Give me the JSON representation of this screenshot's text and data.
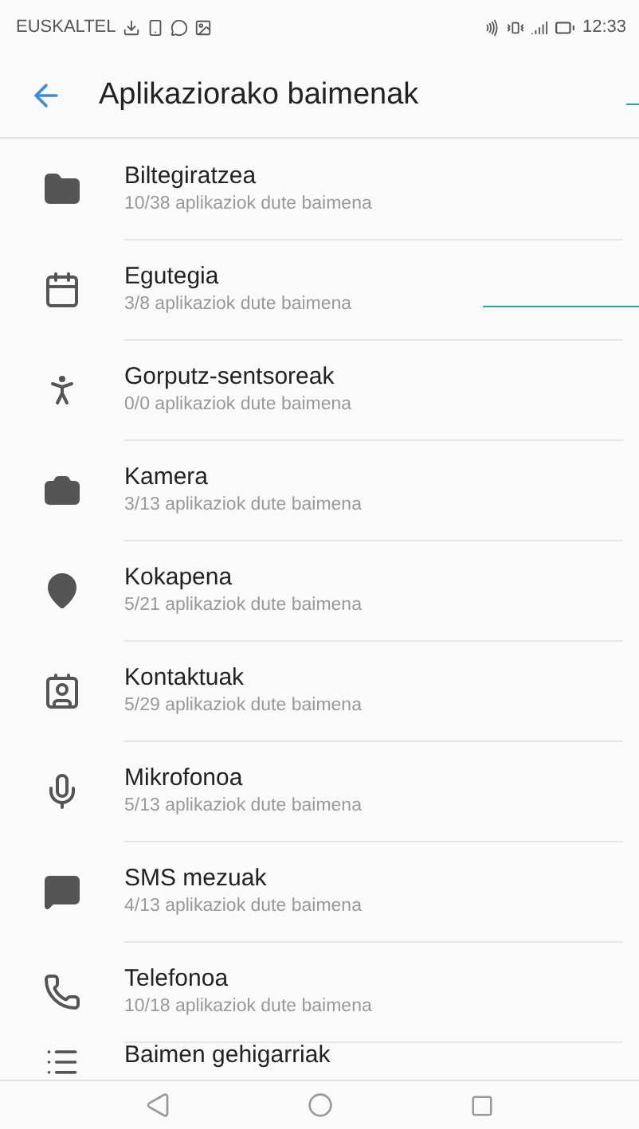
{
  "status_bar": {
    "carrier": "EUSKALTEL",
    "time": "12:33"
  },
  "header": {
    "title": "Aplikaziorako baimenak"
  },
  "permissions": [
    {
      "title": "Biltegiratzea",
      "subtitle": "10/38 aplikaziok dute baimena"
    },
    {
      "title": "Egutegia",
      "subtitle": "3/8 aplikaziok dute baimena"
    },
    {
      "title": "Gorputz-sentsoreak",
      "subtitle": "0/0 aplikaziok dute baimena"
    },
    {
      "title": "Kamera",
      "subtitle": "3/13 aplikaziok dute baimena"
    },
    {
      "title": "Kokapena",
      "subtitle": "5/21 aplikaziok dute baimena"
    },
    {
      "title": "Kontaktuak",
      "subtitle": "5/29 aplikaziok dute baimena"
    },
    {
      "title": "Mikrofonoa",
      "subtitle": "5/13 aplikaziok dute baimena"
    },
    {
      "title": "SMS mezuak",
      "subtitle": "4/13 aplikaziok dute baimena"
    },
    {
      "title": "Telefonoa",
      "subtitle": "10/18 aplikaziok dute baimena"
    },
    {
      "title": "Baimen gehigarriak"
    }
  ]
}
